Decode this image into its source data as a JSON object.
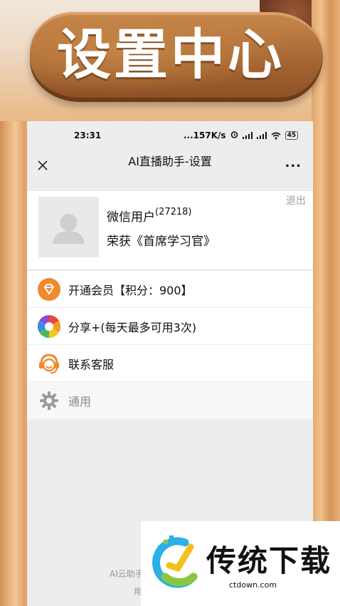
{
  "banner": {
    "title": "设置中心"
  },
  "statusbar": {
    "time": "23:31",
    "network": "...157K/s",
    "battery": "45"
  },
  "navbar": {
    "title": "AI直播助手-设置",
    "more": "..."
  },
  "profile": {
    "name": "微信用户",
    "uid": "(27218)",
    "honor": "荣获《首席学习官》",
    "logout": "退出"
  },
  "menu": {
    "items": [
      {
        "label": "开通会员【积分：900】",
        "icon": "diamond-icon"
      },
      {
        "label": "分享+(每天最多可用3次)",
        "icon": "shutter-icon"
      },
      {
        "label": "联系客服",
        "icon": "customer-service-icon"
      },
      {
        "label": "通用",
        "icon": "gear-icon"
      }
    ]
  },
  "footer": {
    "line1": "AI云助手",
    "line2": "用"
  },
  "watermark": {
    "title": "传统下载",
    "domain": "ctdown.com"
  },
  "colors": {
    "accent_orange": "#f08a2c",
    "background_gray": "#ededed"
  }
}
